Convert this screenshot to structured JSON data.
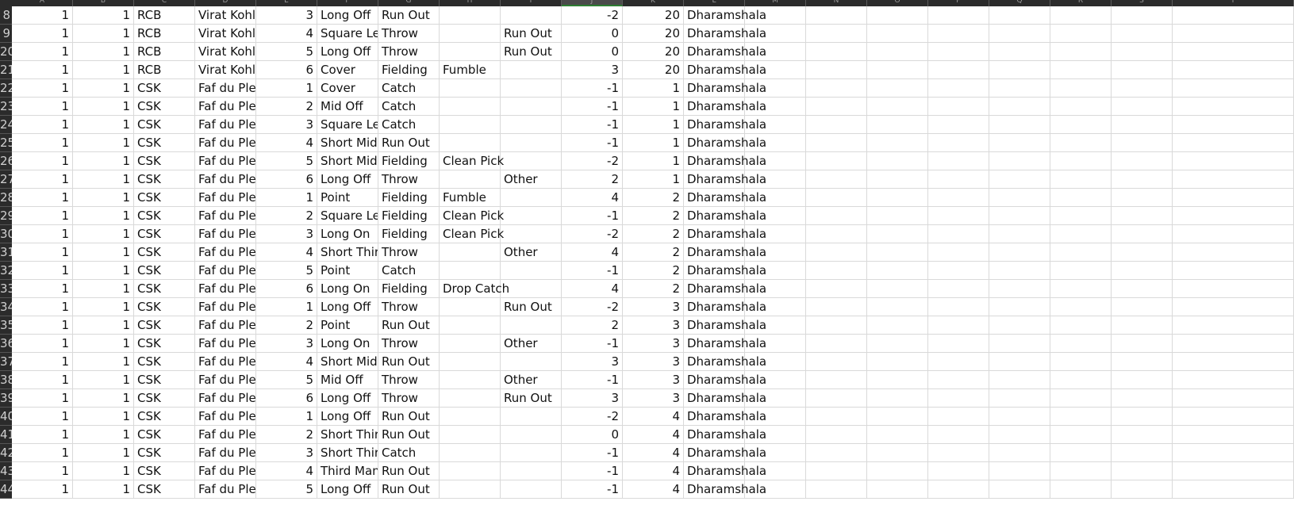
{
  "sheet": {
    "columns": [
      "A",
      "B",
      "C",
      "D",
      "E",
      "F",
      "G",
      "H",
      "I",
      "J",
      "K",
      "L",
      "M",
      "N",
      "O",
      "P",
      "Q",
      "R",
      "S",
      "T"
    ],
    "active_column": "J",
    "rows": [
      {
        "n": "8",
        "c": [
          "1",
          "1",
          "RCB",
          "Virat Kohli",
          "3",
          "Long Off",
          "Run Out",
          "",
          "",
          "-2",
          "20",
          "Dharamshala"
        ]
      },
      {
        "n": "9",
        "c": [
          "1",
          "1",
          "RCB",
          "Virat Kohli",
          "4",
          "Square Leg",
          "Throw",
          "",
          "Run Out",
          "0",
          "20",
          "Dharamshala"
        ]
      },
      {
        "n": "20",
        "c": [
          "1",
          "1",
          "RCB",
          "Virat Kohli",
          "5",
          "Long Off",
          "Throw",
          "",
          "Run Out",
          "0",
          "20",
          "Dharamshala"
        ]
      },
      {
        "n": "21",
        "c": [
          "1",
          "1",
          "RCB",
          "Virat Kohli",
          "6",
          "Cover",
          "Fielding",
          "Fumble",
          "",
          "3",
          "20",
          "Dharamshala"
        ]
      },
      {
        "n": "22",
        "c": [
          "1",
          "1",
          "CSK",
          "Faf du Plessis",
          "1",
          "Cover",
          "Catch",
          "",
          "",
          "-1",
          "1",
          "Dharamshala"
        ]
      },
      {
        "n": "23",
        "c": [
          "1",
          "1",
          "CSK",
          "Faf du Plessis",
          "2",
          "Mid Off",
          "Catch",
          "",
          "",
          "-1",
          "1",
          "Dharamshala"
        ]
      },
      {
        "n": "24",
        "c": [
          "1",
          "1",
          "CSK",
          "Faf du Plessis",
          "3",
          "Square Leg",
          "Catch",
          "",
          "",
          "-1",
          "1",
          "Dharamshala"
        ]
      },
      {
        "n": "25",
        "c": [
          "1",
          "1",
          "CSK",
          "Faf du Plessis",
          "4",
          "Short Mid",
          "Run Out",
          "",
          "",
          "-1",
          "1",
          "Dharamshala"
        ]
      },
      {
        "n": "26",
        "c": [
          "1",
          "1",
          "CSK",
          "Faf du Plessis",
          "5",
          "Short Mid",
          "Fielding",
          "Clean Pick",
          "",
          "-2",
          "1",
          "Dharamshala"
        ]
      },
      {
        "n": "27",
        "c": [
          "1",
          "1",
          "CSK",
          "Faf du Plessis",
          "6",
          "Long Off",
          "Throw",
          "",
          "Other",
          "2",
          "1",
          "Dharamshala"
        ]
      },
      {
        "n": "28",
        "c": [
          "1",
          "1",
          "CSK",
          "Faf du Plessis",
          "1",
          "Point",
          "Fielding",
          "Fumble",
          "",
          "4",
          "2",
          "Dharamshala"
        ]
      },
      {
        "n": "29",
        "c": [
          "1",
          "1",
          "CSK",
          "Faf du Plessis",
          "2",
          "Square Leg",
          "Fielding",
          "Clean Pick",
          "",
          "-1",
          "2",
          "Dharamshala"
        ]
      },
      {
        "n": "30",
        "c": [
          "1",
          "1",
          "CSK",
          "Faf du Plessis",
          "3",
          "Long On",
          "Fielding",
          "Clean Pick",
          "",
          "-2",
          "2",
          "Dharamshala"
        ]
      },
      {
        "n": "31",
        "c": [
          "1",
          "1",
          "CSK",
          "Faf du Plessis",
          "4",
          "Short Third",
          "Throw",
          "",
          "Other",
          "4",
          "2",
          "Dharamshala"
        ]
      },
      {
        "n": "32",
        "c": [
          "1",
          "1",
          "CSK",
          "Faf du Plessis",
          "5",
          "Point",
          "Catch",
          "",
          "",
          "-1",
          "2",
          "Dharamshala"
        ]
      },
      {
        "n": "33",
        "c": [
          "1",
          "1",
          "CSK",
          "Faf du Plessis",
          "6",
          "Long On",
          "Fielding",
          "Drop Catch",
          "",
          "4",
          "2",
          "Dharamshala"
        ]
      },
      {
        "n": "34",
        "c": [
          "1",
          "1",
          "CSK",
          "Faf du Plessis",
          "1",
          "Long Off",
          "Throw",
          "",
          "Run Out",
          "-2",
          "3",
          "Dharamshala"
        ]
      },
      {
        "n": "35",
        "c": [
          "1",
          "1",
          "CSK",
          "Faf du Plessis",
          "2",
          "Point",
          "Run Out",
          "",
          "",
          "2",
          "3",
          "Dharamshala"
        ]
      },
      {
        "n": "36",
        "c": [
          "1",
          "1",
          "CSK",
          "Faf du Plessis",
          "3",
          "Long On",
          "Throw",
          "",
          "Other",
          "-1",
          "3",
          "Dharamshala"
        ]
      },
      {
        "n": "37",
        "c": [
          "1",
          "1",
          "CSK",
          "Faf du Plessis",
          "4",
          "Short Mid",
          "Run Out",
          "",
          "",
          "3",
          "3",
          "Dharamshala"
        ]
      },
      {
        "n": "38",
        "c": [
          "1",
          "1",
          "CSK",
          "Faf du Plessis",
          "5",
          "Mid Off",
          "Throw",
          "",
          "Other",
          "-1",
          "3",
          "Dharamshala"
        ]
      },
      {
        "n": "39",
        "c": [
          "1",
          "1",
          "CSK",
          "Faf du Plessis",
          "6",
          "Long Off",
          "Throw",
          "",
          "Run Out",
          "3",
          "3",
          "Dharamshala"
        ]
      },
      {
        "n": "40",
        "c": [
          "1",
          "1",
          "CSK",
          "Faf du Plessis",
          "1",
          "Long Off",
          "Run Out",
          "",
          "",
          "-2",
          "4",
          "Dharamshala"
        ]
      },
      {
        "n": "41",
        "c": [
          "1",
          "1",
          "CSK",
          "Faf du Plessis",
          "2",
          "Short Third",
          "Run Out",
          "",
          "",
          "0",
          "4",
          "Dharamshala"
        ]
      },
      {
        "n": "42",
        "c": [
          "1",
          "1",
          "CSK",
          "Faf du Plessis",
          "3",
          "Short Third",
          "Catch",
          "",
          "",
          "-1",
          "4",
          "Dharamshala"
        ]
      },
      {
        "n": "43",
        "c": [
          "1",
          "1",
          "CSK",
          "Faf du Plessis",
          "4",
          "Third Man",
          "Run Out",
          "",
          "",
          "-1",
          "4",
          "Dharamshala"
        ]
      },
      {
        "n": "44",
        "c": [
          "1",
          "1",
          "CSK",
          "Faf du Plessis",
          "5",
          "Long Off",
          "Run Out",
          "",
          "",
          "-1",
          "4",
          "Dharamshala"
        ]
      }
    ]
  }
}
